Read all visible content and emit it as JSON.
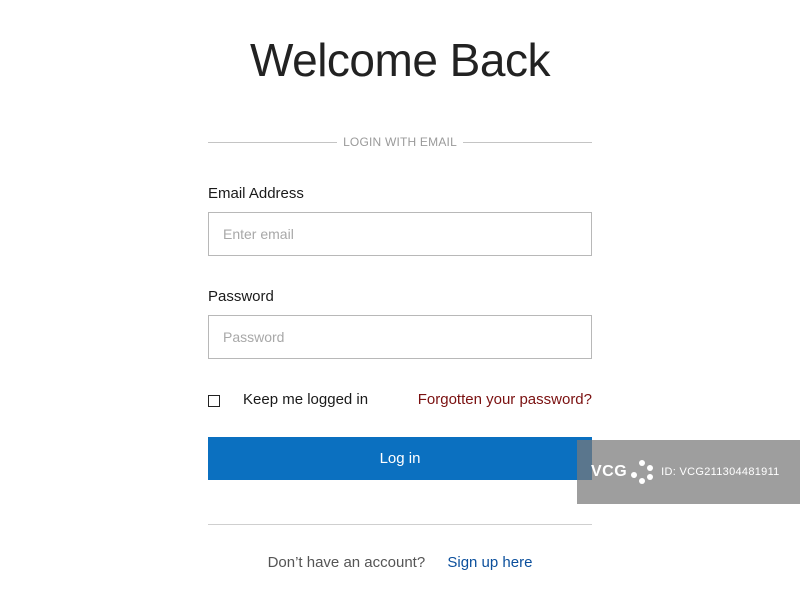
{
  "header": {
    "title": "Welcome Back"
  },
  "login_with_email": {
    "label": "LOGIN WITH EMAIL"
  },
  "form": {
    "email_label": "Email Address",
    "email_placeholder": "Enter email",
    "email_value": "",
    "password_label": "Password",
    "password_placeholder": "Password",
    "password_value": "",
    "keep_logged_in_label": "Keep me logged in",
    "keep_logged_in_checked": false,
    "forgot_password_link": "Forgotten your password?",
    "login_button_label": "Log in"
  },
  "footer": {
    "no_account_text": "Don’t have an account?",
    "signup_link": "Sign up here"
  },
  "watermark": {
    "brand": "VCG",
    "id_text": "ID: VCG211304481911"
  },
  "colors": {
    "primary_button": "#0b70c0",
    "forgot_link": "#7a1010",
    "signup_link": "#0b4f9c"
  },
  "icons": {
    "watermark_logo": "vcg-logo-icon"
  }
}
